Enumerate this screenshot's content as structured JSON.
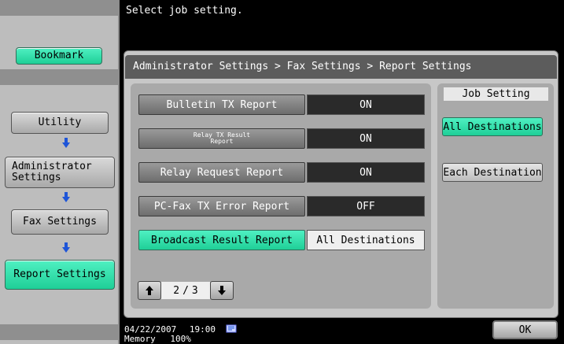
{
  "message": "Select job setting.",
  "sidebar": {
    "bookmark_label": "Bookmark",
    "utility_label": "Utility",
    "admin_label": "Administrator Settings",
    "fax_label": "Fax Settings",
    "report_label": "Report Settings"
  },
  "breadcrumb": "Administrator Settings > Fax Settings > Report Settings",
  "rows": [
    {
      "label": "Bulletin TX Report",
      "value": "ON"
    },
    {
      "label": "Relay TX Result Report",
      "value": "ON"
    },
    {
      "label": "Relay Request Report",
      "value": "ON"
    },
    {
      "label": "PC-Fax TX Error Report",
      "value": "OFF"
    },
    {
      "label": "Broadcast Result Report",
      "value": "All Destinations"
    }
  ],
  "relay_label_line1": "Relay TX Result",
  "relay_label_line2": "Report",
  "job_setting": {
    "title": "Job Setting",
    "all_label": "All Destinations",
    "each_label": "Each Destination"
  },
  "pager": {
    "current": "2",
    "sep": "/",
    "total": "3"
  },
  "footer": {
    "date": "04/22/2007",
    "time": "19:00",
    "memory_label": "Memory",
    "memory_value": "100%",
    "ok_label": "OK"
  },
  "colors": {
    "accent_green": "#1fcf97",
    "arrow_blue": "#1e55d8"
  }
}
